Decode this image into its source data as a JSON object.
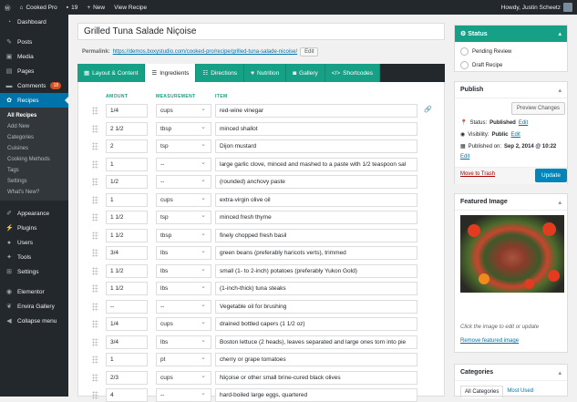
{
  "adminbar": {
    "site": "Cooked Pro",
    "updates": "19",
    "new": "New",
    "view": "View Recipe",
    "howdy": "Howdy, Justin Scheetz"
  },
  "menu": {
    "dashboard": "Dashboard",
    "posts": "Posts",
    "media": "Media",
    "pages": "Pages",
    "comments": "Comments",
    "comments_count": "18",
    "recipes": "Recipes",
    "sub": [
      "All Recipes",
      "Add New",
      "Categories",
      "Cuisines",
      "Cooking Methods",
      "Tags",
      "Settings",
      "What's New?"
    ],
    "appearance": "Appearance",
    "plugins": "Plugins",
    "users": "Users",
    "tools": "Tools",
    "settings": "Settings",
    "elementor": "Elementor",
    "envira": "Envira Gallery",
    "collapse": "Collapse menu"
  },
  "post": {
    "title": "Grilled Tuna Salade Niçoise",
    "permalink_label": "Permalink:",
    "permalink_base": "https://demos.boxystudio.com/cooked-pro/recipe/",
    "permalink_slug": "grilled-tuna-salade-nicoise",
    "permalink_end": "/",
    "edit": "Edit"
  },
  "tabs": [
    "Layout & Content",
    "Ingredients",
    "Directions",
    "Nutrition",
    "Gallery",
    "Shortcodes"
  ],
  "headers": {
    "amount": "AMOUNT",
    "measurement": "MEASUREMENT",
    "item": "ITEM"
  },
  "ingredients": [
    {
      "amount": "1/4",
      "unit": "cups",
      "item": "red-wine vinegar"
    },
    {
      "amount": "2 1/2",
      "unit": "tbsp",
      "item": "minced shallot"
    },
    {
      "amount": "2",
      "unit": "tsp",
      "item": "Dijon mustard"
    },
    {
      "amount": "1",
      "unit": "--",
      "item": "large garlic clove, minced and mashed to a paste with 1/2 teaspoon sal"
    },
    {
      "amount": "1/2",
      "unit": "--",
      "item": "(rounded) anchovy paste"
    },
    {
      "amount": "1",
      "unit": "cups",
      "item": "extra-virgin olive oil"
    },
    {
      "amount": "1 1/2",
      "unit": "tsp",
      "item": "minced fresh thyme"
    },
    {
      "amount": "1 1/2",
      "unit": "tbsp",
      "item": "finely chopped fresh basil"
    },
    {
      "amount": "3/4",
      "unit": "lbs",
      "item": "green beans (preferably haricots verts), trimmed"
    },
    {
      "amount": "1 1/2",
      "unit": "lbs",
      "item": "small (1- to 2-inch) potatoes (preferably Yukon Gold)"
    },
    {
      "amount": "1 1/2",
      "unit": "lbs",
      "item": "(1-inch-thick) tuna steaks"
    },
    {
      "amount": "--",
      "unit": "--",
      "item": "Vegetable oil for brushing"
    },
    {
      "amount": "1/4",
      "unit": "cups",
      "item": "drained bottled capers (1 1/2 oz)"
    },
    {
      "amount": "3/4",
      "unit": "lbs",
      "item": "Boston lettuce (2 heads), leaves separated and large ones torn into pie"
    },
    {
      "amount": "1",
      "unit": "pt",
      "item": "cherry or grape tomatoes"
    },
    {
      "amount": "2/3",
      "unit": "cups",
      "item": "Niçoise or other small brine-cured black olives"
    },
    {
      "amount": "4",
      "unit": "--",
      "item": "hard-boiled large eggs, quartered"
    }
  ],
  "status_box": {
    "title": "Status",
    "options": [
      "Pending Review",
      "Draft Recipe"
    ]
  },
  "publish": {
    "title": "Publish",
    "preview": "Preview Changes",
    "status_label": "Status:",
    "status": "Published",
    "visibility_label": "Visibility:",
    "visibility": "Public",
    "published_label": "Published on:",
    "published": "Sep 2, 2014 @ 10:22",
    "edit": "Edit",
    "trash": "Move to Trash",
    "update": "Update"
  },
  "featured": {
    "title": "Featured Image",
    "hint": "Click the image to edit or update",
    "remove": "Remove featured image"
  },
  "categories": {
    "title": "Categories",
    "tab_all": "All Categories",
    "tab_used": "Most Used"
  }
}
